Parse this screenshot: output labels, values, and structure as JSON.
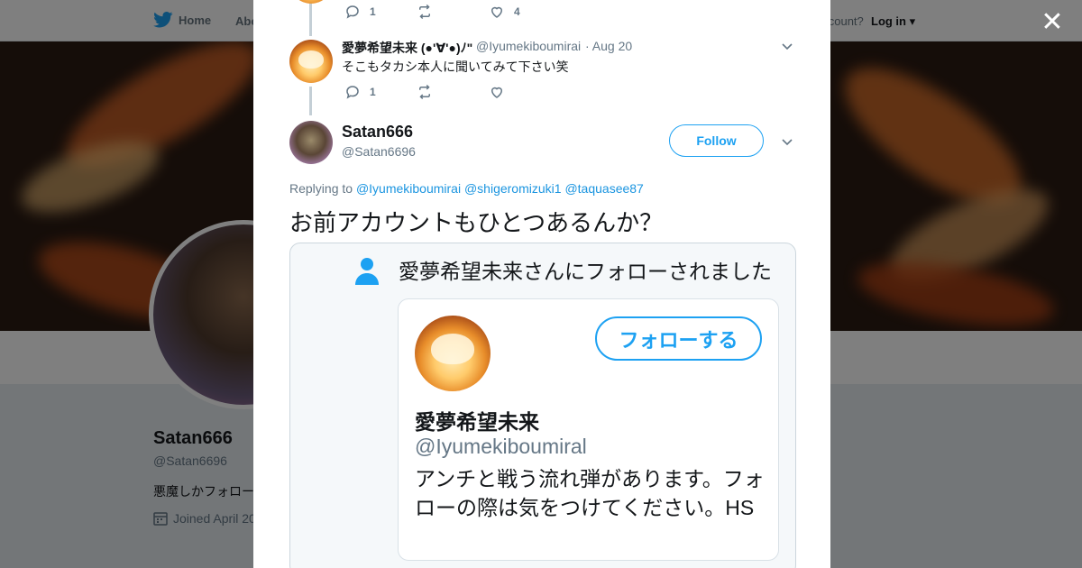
{
  "nav": {
    "home_label": "Home",
    "about_label": "About",
    "account_text": "account?",
    "login_label": "Log in"
  },
  "profile": {
    "name": "Satan666",
    "handle": "@Satan6696",
    "bio": "悪魔しかフォロー",
    "joined": "Joined April 20"
  },
  "modal": {
    "prev_tweet_actions": {
      "replies": "1",
      "likes": "4"
    },
    "reply_tweet": {
      "name": "愛夢希望未来 (●'∀'●)ﾉ\"",
      "handle": "@Iyumekiboumirai",
      "date": "· Aug 20",
      "text": "そこもタカシ本人に聞いてみて下さい笑",
      "replies": "1"
    },
    "main_tweet": {
      "name": "Satan666",
      "handle": "@Satan6696",
      "follow_label": "Follow",
      "replying_prefix": "Replying to",
      "mentions": [
        "@Iyumekiboumirai",
        "@shigeromizuki1",
        "@taquasee87"
      ],
      "text": "お前アカウントもひとつあるんか？"
    },
    "media": {
      "notif_text": "愛夢希望未来さんにフォローされました",
      "card_follow_label": "フォローする",
      "card_name": "愛夢希望未来",
      "card_handle": "@Iyumekiboumiral",
      "card_bio": "アンチと戦う流れ弾があります。フォローの際は気をつけてください。HS"
    }
  },
  "colors": {
    "accent": "#1da1f2",
    "muted": "#657786",
    "overlay": "rgba(0,0,0,0.5)"
  },
  "icons": {
    "twitter": "twitter-bird-icon",
    "close": "close-icon",
    "reply": "reply-icon",
    "retweet": "retweet-icon",
    "like": "heart-icon",
    "chevron": "chevron-down-icon",
    "person": "person-icon",
    "calendar": "calendar-icon"
  }
}
